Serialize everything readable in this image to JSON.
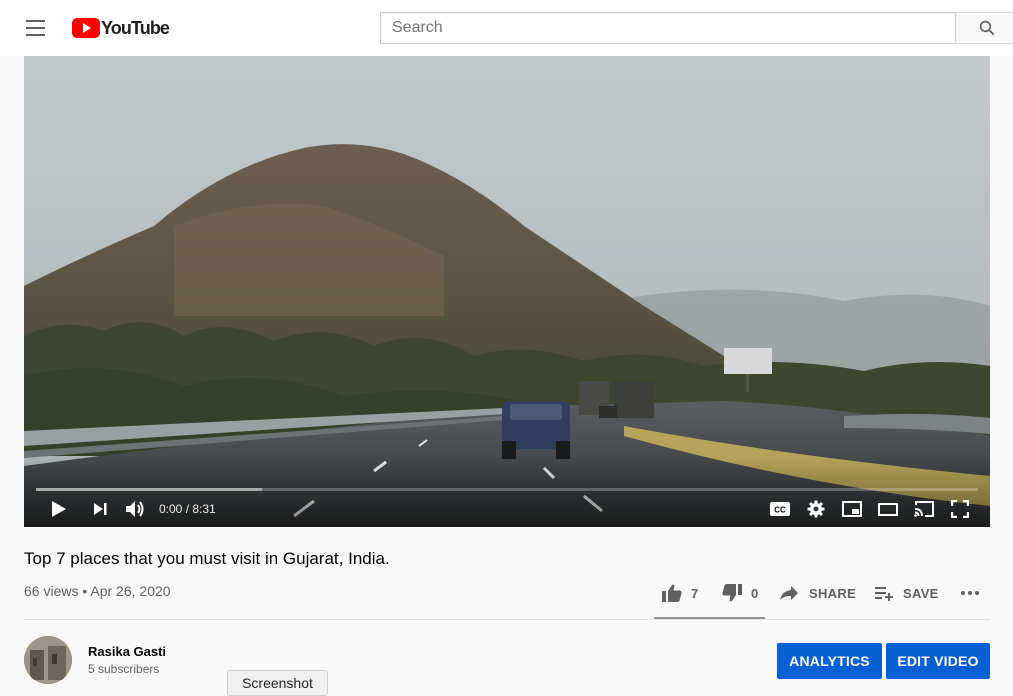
{
  "header": {
    "logo_text": "YouTube",
    "search_placeholder": "Search"
  },
  "player": {
    "time_display": "0:00 / 8:31",
    "buffered_fraction": 0.24,
    "played_fraction": 0
  },
  "video": {
    "title": "Top 7 places that you must visit in Gujarat, India.",
    "meta": "66 views • Apr 26, 2020",
    "like_count": "7",
    "dislike_count": "0",
    "share_label": "SHARE",
    "save_label": "SAVE"
  },
  "owner": {
    "channel_name": "Rasika Gasti",
    "subscribers": "5 subscribers",
    "analytics_label": "ANALYTICS",
    "edit_label": "EDIT VIDEO"
  },
  "tooltip": {
    "text": "Screenshot"
  },
  "colors": {
    "brand_red": "#ff0000",
    "action_blue": "#065fd4",
    "text_secondary": "#606060"
  },
  "icons": [
    "menu-icon",
    "youtube-logo-icon",
    "search-icon",
    "play-icon",
    "next-icon",
    "volume-icon",
    "captions-icon",
    "settings-icon",
    "miniplayer-icon",
    "theater-icon",
    "cast-icon",
    "fullscreen-icon",
    "like-icon",
    "dislike-icon",
    "share-icon",
    "save-playlist-icon",
    "more-icon"
  ]
}
